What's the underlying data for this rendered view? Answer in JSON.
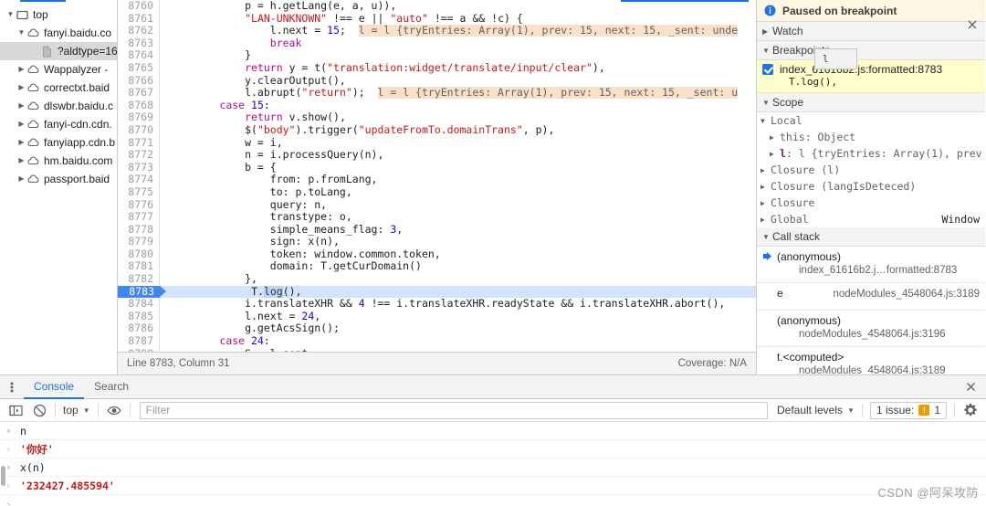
{
  "navigator": {
    "items": [
      {
        "label": "top",
        "icon": "frame-icon",
        "twisty": "▼",
        "indent": 0,
        "selected": false
      },
      {
        "label": "fanyi.baidu.co",
        "icon": "cloud-icon",
        "twisty": "▼",
        "indent": 1,
        "selected": false
      },
      {
        "label": "?aldtype=16",
        "icon": "file-icon",
        "twisty": "",
        "indent": 2,
        "selected": true
      },
      {
        "label": "Wappalyzer - ",
        "icon": "cloud-icon",
        "twisty": "▶",
        "indent": 1,
        "selected": false
      },
      {
        "label": "correctxt.baid",
        "icon": "cloud-icon",
        "twisty": "▶",
        "indent": 1,
        "selected": false
      },
      {
        "label": "dlswbr.baidu.c",
        "icon": "cloud-icon",
        "twisty": "▶",
        "indent": 1,
        "selected": false
      },
      {
        "label": "fanyi-cdn.cdn.",
        "icon": "cloud-icon",
        "twisty": "▶",
        "indent": 1,
        "selected": false
      },
      {
        "label": "fanyiapp.cdn.b",
        "icon": "cloud-icon",
        "twisty": "▶",
        "indent": 1,
        "selected": false
      },
      {
        "label": "hm.baidu.com",
        "icon": "cloud-icon",
        "twisty": "▶",
        "indent": 1,
        "selected": false
      },
      {
        "label": "passport.baid",
        "icon": "cloud-icon",
        "twisty": "▶",
        "indent": 1,
        "selected": false
      }
    ]
  },
  "editor": {
    "active_line": 8783,
    "lines": [
      {
        "n": "8760",
        "tokens": [
          {
            "t": "plain",
            "v": "            p = h.getLang(e, a, u)),"
          }
        ]
      },
      {
        "n": "8761",
        "tokens": [
          {
            "t": "plain",
            "v": "            "
          },
          {
            "t": "str",
            "v": "\"LAN-UNKNOWN\""
          },
          {
            "t": "plain",
            "v": " !== e || "
          },
          {
            "t": "str",
            "v": "\"auto\""
          },
          {
            "t": "plain",
            "v": " !== a && !c) {"
          }
        ]
      },
      {
        "n": "8762",
        "tokens": [
          {
            "t": "plain",
            "v": "                l.next = "
          },
          {
            "t": "num",
            "v": "15"
          },
          {
            "t": "plain",
            "v": ";  "
          },
          {
            "t": "inline",
            "v": "l = l {tryEntries: Array(1), prev: 15, next: 15, _sent: unde"
          }
        ]
      },
      {
        "n": "8763",
        "tokens": [
          {
            "t": "key",
            "v": "                break"
          }
        ]
      },
      {
        "n": "8764",
        "tokens": [
          {
            "t": "plain",
            "v": "            }"
          }
        ]
      },
      {
        "n": "8765",
        "tokens": [
          {
            "t": "plain",
            "v": "            "
          },
          {
            "t": "key",
            "v": "return"
          },
          {
            "t": "plain",
            "v": " y = t("
          },
          {
            "t": "str",
            "v": "\"translation:widget/translate/input/clear\""
          },
          {
            "t": "plain",
            "v": "),"
          }
        ]
      },
      {
        "n": "8766",
        "tokens": [
          {
            "t": "plain",
            "v": "            y.clearOutput(),"
          }
        ]
      },
      {
        "n": "8767",
        "tokens": [
          {
            "t": "plain",
            "v": "            l.abrupt("
          },
          {
            "t": "str",
            "v": "\"return\""
          },
          {
            "t": "plain",
            "v": ");  "
          },
          {
            "t": "inline",
            "v": "l = l {tryEntries: Array(1), prev: 15, next: 15, _sent: u"
          }
        ]
      },
      {
        "n": "8768",
        "tokens": [
          {
            "t": "plain",
            "v": "        "
          },
          {
            "t": "key",
            "v": "case"
          },
          {
            "t": "plain",
            "v": " "
          },
          {
            "t": "num",
            "v": "15"
          },
          {
            "t": "plain",
            "v": ":"
          }
        ]
      },
      {
        "n": "8769",
        "tokens": [
          {
            "t": "plain",
            "v": "            "
          },
          {
            "t": "key",
            "v": "return"
          },
          {
            "t": "plain",
            "v": " v.show(),"
          }
        ]
      },
      {
        "n": "8770",
        "tokens": [
          {
            "t": "plain",
            "v": "            $("
          },
          {
            "t": "str",
            "v": "\"body\""
          },
          {
            "t": "plain",
            "v": ").trigger("
          },
          {
            "t": "str",
            "v": "\"updateFromTo.domainTrans\""
          },
          {
            "t": "plain",
            "v": ", p),"
          }
        ]
      },
      {
        "n": "8771",
        "tokens": [
          {
            "t": "plain",
            "v": "            w = i,"
          }
        ]
      },
      {
        "n": "8772",
        "tokens": [
          {
            "t": "plain",
            "v": "            n = i.processQuery(n),"
          }
        ]
      },
      {
        "n": "8773",
        "tokens": [
          {
            "t": "plain",
            "v": "            b = {"
          }
        ]
      },
      {
        "n": "8774",
        "tokens": [
          {
            "t": "plain",
            "v": "                from: p.fromLang,"
          }
        ]
      },
      {
        "n": "8775",
        "tokens": [
          {
            "t": "plain",
            "v": "                to: p.toLang,"
          }
        ]
      },
      {
        "n": "8776",
        "tokens": [
          {
            "t": "plain",
            "v": "                query: n,"
          }
        ]
      },
      {
        "n": "8777",
        "tokens": [
          {
            "t": "plain",
            "v": "                transtype: o,"
          }
        ]
      },
      {
        "n": "8778",
        "tokens": [
          {
            "t": "plain",
            "v": "                simple_means_flag: "
          },
          {
            "t": "num",
            "v": "3"
          },
          {
            "t": "plain",
            "v": ","
          }
        ]
      },
      {
        "n": "8779",
        "tokens": [
          {
            "t": "plain",
            "v": "                sign: x(n),"
          }
        ]
      },
      {
        "n": "8780",
        "tokens": [
          {
            "t": "plain",
            "v": "                token: window.common.token,"
          }
        ]
      },
      {
        "n": "8781",
        "tokens": [
          {
            "t": "plain",
            "v": "                domain: T.getCurDomain()"
          }
        ]
      },
      {
        "n": "8782",
        "tokens": [
          {
            "t": "plain",
            "v": "            },"
          }
        ]
      },
      {
        "n": "8783",
        "tokens": [
          {
            "t": "plain",
            "v": "            T."
          },
          {
            "t": "sel",
            "v": "log"
          },
          {
            "t": "plain",
            "v": "(),"
          }
        ],
        "active": true
      },
      {
        "n": "8784",
        "tokens": [
          {
            "t": "plain",
            "v": "            i.translateXHR && "
          },
          {
            "t": "num",
            "v": "4"
          },
          {
            "t": "plain",
            "v": " !== i.translateXHR.readyState && i.translateXHR.abort(),"
          }
        ]
      },
      {
        "n": "8785",
        "tokens": [
          {
            "t": "plain",
            "v": "            l.next = "
          },
          {
            "t": "num",
            "v": "24"
          },
          {
            "t": "plain",
            "v": ","
          }
        ]
      },
      {
        "n": "8786",
        "tokens": [
          {
            "t": "plain",
            "v": "            g.getAcsSign();"
          }
        ]
      },
      {
        "n": "8787",
        "tokens": [
          {
            "t": "plain",
            "v": "        "
          },
          {
            "t": "key",
            "v": "case"
          },
          {
            "t": "plain",
            "v": " "
          },
          {
            "t": "num",
            "v": "24"
          },
          {
            "t": "plain",
            "v": ":"
          }
        ]
      },
      {
        "n": "8788",
        "tokens": [
          {
            "t": "plain",
            "v": "            S = l.sent"
          }
        ]
      }
    ],
    "status": {
      "position": "Line 8783, Column 31",
      "coverage": "Coverage: N/A"
    }
  },
  "debugger": {
    "paused_text": "Paused on breakpoint",
    "paused_icon": "info-icon",
    "close_icon": "close-icon",
    "sections": {
      "watch": {
        "label": "Watch",
        "twisty": "▶"
      },
      "breakpoints": {
        "label": "Breakpoints",
        "twisty": "▼",
        "tooltip": "l"
      },
      "scope": {
        "label": "Scope",
        "twisty": "▼"
      },
      "callstack": {
        "label": "Call stack",
        "twisty": "▼"
      }
    },
    "breakpoint_item": {
      "checked": true,
      "location": "index_61616b2.js:formatted:8783",
      "code": "T.log(),"
    },
    "scope": [
      {
        "twisty": "▼",
        "indent": 0,
        "name": "Local",
        "value": "",
        "right": "",
        "hl": false
      },
      {
        "twisty": "▶",
        "indent": 1,
        "name": "this",
        "value": ": Object",
        "right": "",
        "hl": false
      },
      {
        "twisty": "▶",
        "indent": 1,
        "name": "l",
        "value": ": l {tryEntries: Array(1), prev",
        "right": "",
        "hl": true
      },
      {
        "twisty": "▶",
        "indent": 0,
        "name": "Closure (l)",
        "value": "",
        "right": "",
        "hl": false
      },
      {
        "twisty": "▶",
        "indent": 0,
        "name": "Closure (langIsDeteced)",
        "value": "",
        "right": "",
        "hl": false
      },
      {
        "twisty": "▶",
        "indent": 0,
        "name": "Closure",
        "value": "",
        "right": "",
        "hl": false
      },
      {
        "twisty": "▶",
        "indent": 0,
        "name": "Global",
        "value": "",
        "right": "Window",
        "hl": false
      }
    ],
    "call_stack": [
      {
        "marker": "➤",
        "fn": "(anonymous)",
        "loc": "index_61616b2.j…formatted:8783",
        "stacked": true
      },
      {
        "marker": "",
        "fn": "e",
        "loc": "nodeModules_4548064.js:3189",
        "stacked": false
      },
      {
        "marker": "",
        "fn": "(anonymous)",
        "loc": "nodeModules_4548064.js:3196",
        "stacked": true
      },
      {
        "marker": "",
        "fn": "t.<computed>",
        "loc": "nodeModules_4548064.js:3189",
        "stacked": true
      }
    ]
  },
  "drawer": {
    "kebab_icon": "more-options-icon",
    "tabs": [
      {
        "label": "Console",
        "active": true
      },
      {
        "label": "Search",
        "active": false
      }
    ],
    "close_icon": "close-icon",
    "toolbar": {
      "sidebar_icon": "console-sidebar-icon",
      "clear_icon": "clear-console-icon",
      "context": "top",
      "context_caret": "▼",
      "eye_icon": "live-expression-icon",
      "filter_placeholder": "Filter",
      "levels": "Default levels",
      "levels_caret": "▼",
      "issues_label": "1 issue:",
      "issues_count": "1",
      "issues_icon": "warning-icon",
      "settings_icon": "gear-icon"
    },
    "console_rows": [
      {
        "type": "input",
        "marker": "›",
        "text": "n"
      },
      {
        "type": "output",
        "marker": "‹",
        "text": "'你好'"
      },
      {
        "type": "input",
        "marker": "›",
        "text": "x(n)"
      },
      {
        "type": "output",
        "marker": "‹",
        "text": "'232427.485594'"
      },
      {
        "type": "prompt",
        "marker": "›",
        "text": ""
      }
    ]
  },
  "watermark": {
    "text": "CSDN @阿呆攻防"
  }
}
